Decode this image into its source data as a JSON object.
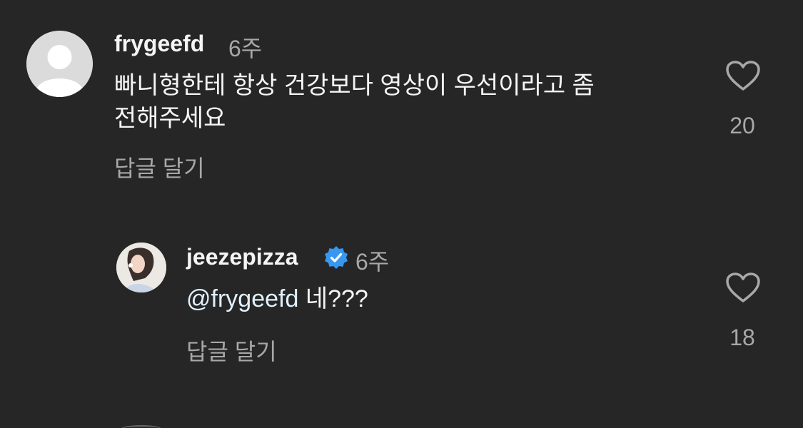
{
  "comments": [
    {
      "username": "frygeefd",
      "time": "6주",
      "text_line1": "빠니형한테 항상 건강보다 영상이 우선이라고 좀",
      "text_line2": "전해주세요",
      "reply_label": "답글 달기",
      "likes": "20",
      "avatar": "default-avatar-icon"
    },
    {
      "username": "jeezepizza",
      "verified": true,
      "time": "6주",
      "mention": "@frygeefd",
      "text": "네???",
      "reply_label": "답글 달기",
      "likes": "18",
      "avatar": "profile-photo"
    }
  ],
  "colors": {
    "background": "#262626",
    "text_primary": "#f5f5f5",
    "text_secondary": "#a8a8a8",
    "verified_badge": "#3897f0"
  }
}
